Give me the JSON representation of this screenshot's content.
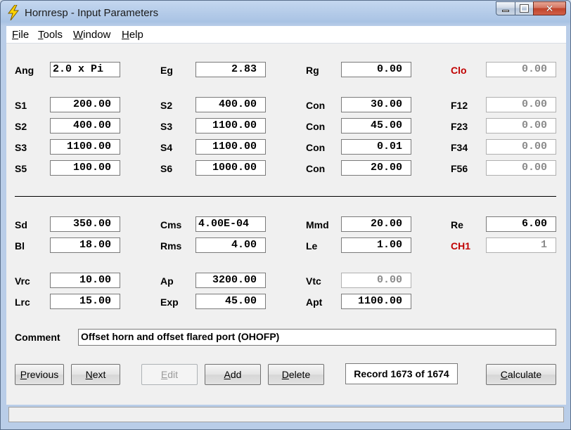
{
  "window": {
    "title": "Hornresp - Input Parameters",
    "close_glyph": "✕"
  },
  "menu": [
    {
      "key": "F",
      "rest": "ile"
    },
    {
      "key": "T",
      "rest": "ools"
    },
    {
      "key": "W",
      "rest": "indow"
    },
    {
      "key": "H",
      "rest": "elp"
    }
  ],
  "fields": {
    "ang": {
      "label": "Ang",
      "value": "2.0 x Pi"
    },
    "eg": {
      "label": "Eg",
      "value": "2.83"
    },
    "rg": {
      "label": "Rg",
      "value": "0.00"
    },
    "clo": {
      "label": "Clo",
      "value": "0.00"
    },
    "s1a": {
      "label": "S1",
      "value": "200.00"
    },
    "s2b": {
      "label": "S2",
      "value": "400.00"
    },
    "con1": {
      "label": "Con",
      "value": "30.00"
    },
    "f12": {
      "label": "F12",
      "value": "0.00"
    },
    "s2a": {
      "label": "S2",
      "value": "400.00"
    },
    "s3b": {
      "label": "S3",
      "value": "1100.00"
    },
    "con2": {
      "label": "Con",
      "value": "45.00"
    },
    "f23": {
      "label": "F23",
      "value": "0.00"
    },
    "s3a": {
      "label": "S3",
      "value": "1100.00"
    },
    "s4b": {
      "label": "S4",
      "value": "1100.00"
    },
    "con3": {
      "label": "Con",
      "value": "0.01"
    },
    "f34": {
      "label": "F34",
      "value": "0.00"
    },
    "s5a": {
      "label": "S5",
      "value": "100.00"
    },
    "s6b": {
      "label": "S6",
      "value": "1000.00"
    },
    "con4": {
      "label": "Con",
      "value": "20.00"
    },
    "f56": {
      "label": "F56",
      "value": "0.00"
    },
    "sd": {
      "label": "Sd",
      "value": "350.00"
    },
    "cms": {
      "label": "Cms",
      "value": "4.00E-04"
    },
    "mmd": {
      "label": "Mmd",
      "value": "20.00"
    },
    "re": {
      "label": "Re",
      "value": "6.00"
    },
    "bl": {
      "label": "Bl",
      "value": "18.00"
    },
    "rms": {
      "label": "Rms",
      "value": "4.00"
    },
    "le": {
      "label": "Le",
      "value": "1.00"
    },
    "ch1": {
      "label": "CH1",
      "value": "1"
    },
    "vrc": {
      "label": "Vrc",
      "value": "10.00"
    },
    "ap": {
      "label": "Ap",
      "value": "3200.00"
    },
    "vtc": {
      "label": "Vtc",
      "value": "0.00"
    },
    "lrc": {
      "label": "Lrc",
      "value": "15.00"
    },
    "exp": {
      "label": "Exp",
      "value": "45.00"
    },
    "apt": {
      "label": "Apt",
      "value": "1100.00"
    }
  },
  "comment": {
    "label": "Comment",
    "value": "Offset horn and offset flared port (OHOFP)"
  },
  "buttons": {
    "previous": {
      "key": "P",
      "rest": "revious"
    },
    "next": {
      "key": "N",
      "rest": "ext"
    },
    "edit": {
      "key": "E",
      "rest": "dit"
    },
    "add": {
      "key": "A",
      "rest": "dd"
    },
    "delete": {
      "key": "D",
      "rest": "elete"
    },
    "calculate": {
      "key": "C",
      "rest": "alculate"
    }
  },
  "record": "Record 1673 of 1674",
  "colors": {
    "label_red": "#c00000",
    "disabled_text": "#8a8a8a",
    "panel": "#f0f0f0"
  },
  "icons": {
    "app": "lightning-bolt-icon"
  }
}
